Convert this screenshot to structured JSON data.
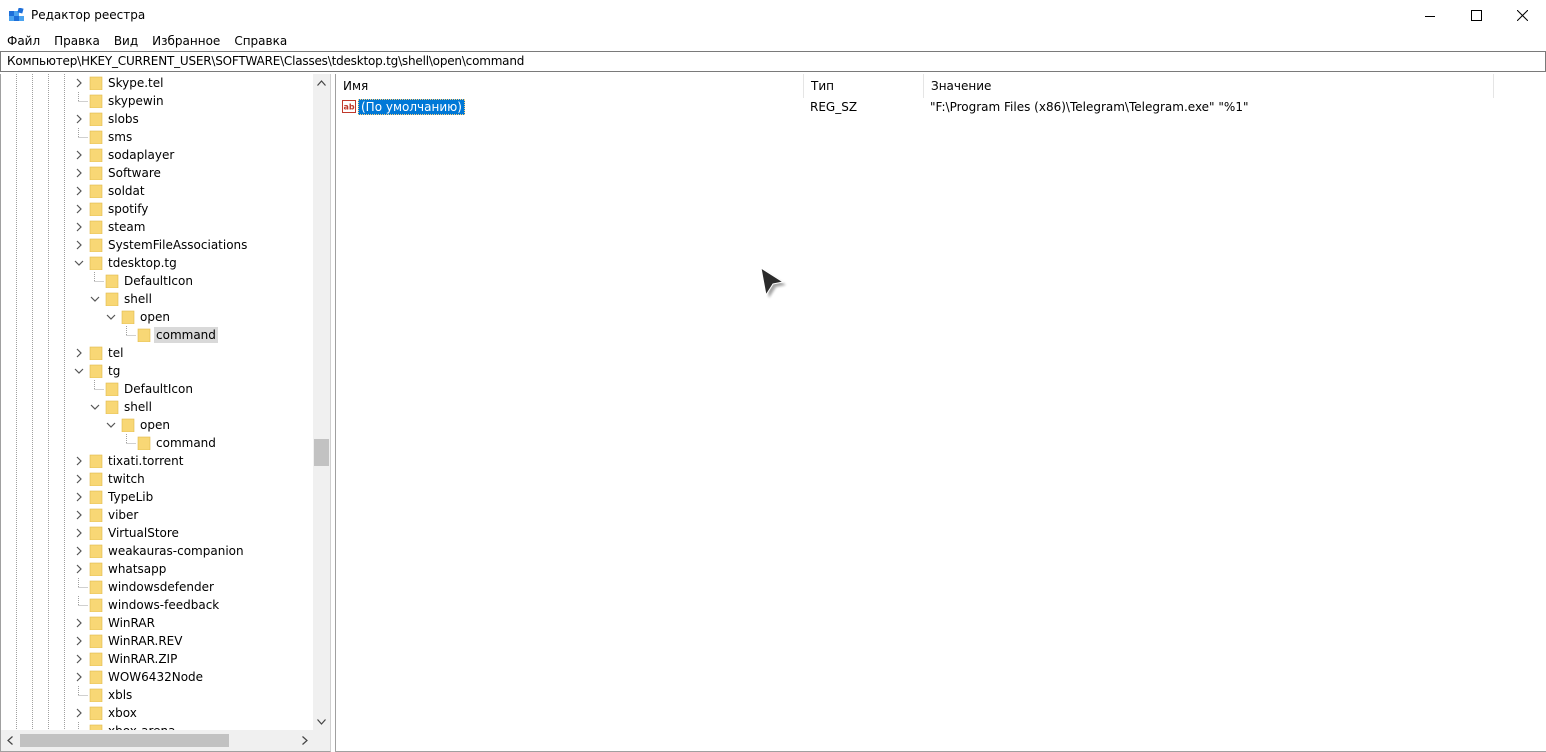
{
  "window": {
    "title": "Редактор реестра",
    "icon": "registry-editor-icon"
  },
  "menu": [
    "Файл",
    "Правка",
    "Вид",
    "Избранное",
    "Справка"
  ],
  "address": "Компьютер\\HKEY_CURRENT_USER\\SOFTWARE\\Classes\\tdesktop.tg\\shell\\open\\command",
  "tree": [
    {
      "label": "Skype.tel",
      "depth": 0,
      "expander": "collapsed"
    },
    {
      "label": "skypewin",
      "depth": 0,
      "expander": "none"
    },
    {
      "label": "slobs",
      "depth": 0,
      "expander": "collapsed"
    },
    {
      "label": "sms",
      "depth": 0,
      "expander": "none"
    },
    {
      "label": "sodaplayer",
      "depth": 0,
      "expander": "collapsed"
    },
    {
      "label": "Software",
      "depth": 0,
      "expander": "collapsed"
    },
    {
      "label": "soldat",
      "depth": 0,
      "expander": "collapsed"
    },
    {
      "label": "spotify",
      "depth": 0,
      "expander": "collapsed"
    },
    {
      "label": "steam",
      "depth": 0,
      "expander": "collapsed"
    },
    {
      "label": "SystemFileAssociations",
      "depth": 0,
      "expander": "collapsed"
    },
    {
      "label": "tdesktop.tg",
      "depth": 0,
      "expander": "expanded"
    },
    {
      "label": "DefaultIcon",
      "depth": 1,
      "expander": "none"
    },
    {
      "label": "shell",
      "depth": 1,
      "expander": "expanded"
    },
    {
      "label": "open",
      "depth": 2,
      "expander": "expanded"
    },
    {
      "label": "command",
      "depth": 3,
      "expander": "none",
      "selected": true
    },
    {
      "label": "tel",
      "depth": 0,
      "expander": "collapsed"
    },
    {
      "label": "tg",
      "depth": 0,
      "expander": "expanded"
    },
    {
      "label": "DefaultIcon",
      "depth": 1,
      "expander": "none"
    },
    {
      "label": "shell",
      "depth": 1,
      "expander": "expanded"
    },
    {
      "label": "open",
      "depth": 2,
      "expander": "expanded"
    },
    {
      "label": "command",
      "depth": 3,
      "expander": "none"
    },
    {
      "label": "tixati.torrent",
      "depth": 0,
      "expander": "collapsed"
    },
    {
      "label": "twitch",
      "depth": 0,
      "expander": "collapsed"
    },
    {
      "label": "TypeLib",
      "depth": 0,
      "expander": "collapsed"
    },
    {
      "label": "viber",
      "depth": 0,
      "expander": "collapsed"
    },
    {
      "label": "VirtualStore",
      "depth": 0,
      "expander": "collapsed"
    },
    {
      "label": "weakauras-companion",
      "depth": 0,
      "expander": "collapsed"
    },
    {
      "label": "whatsapp",
      "depth": 0,
      "expander": "collapsed"
    },
    {
      "label": "windowsdefender",
      "depth": 0,
      "expander": "none"
    },
    {
      "label": "windows-feedback",
      "depth": 0,
      "expander": "none"
    },
    {
      "label": "WinRAR",
      "depth": 0,
      "expander": "collapsed"
    },
    {
      "label": "WinRAR.REV",
      "depth": 0,
      "expander": "collapsed"
    },
    {
      "label": "WinRAR.ZIP",
      "depth": 0,
      "expander": "collapsed"
    },
    {
      "label": "WOW6432Node",
      "depth": 0,
      "expander": "collapsed"
    },
    {
      "label": "xbls",
      "depth": 0,
      "expander": "none"
    },
    {
      "label": "xbox",
      "depth": 0,
      "expander": "collapsed"
    },
    {
      "label": "xbox-arena",
      "depth": 0,
      "expander": "none"
    }
  ],
  "values": {
    "columns": [
      "Имя",
      "Тип",
      "Значение"
    ],
    "rows": [
      {
        "name": "(По умолчанию)",
        "type": "REG_SZ",
        "data": "\"F:\\Program Files (x86)\\Telegram\\Telegram.exe\" \"%1\"",
        "icon": "string-value-icon"
      }
    ]
  },
  "colors": {
    "selection": "#0078d7",
    "tree_selection": "#d9d9d9",
    "folder": "#f8d775"
  }
}
